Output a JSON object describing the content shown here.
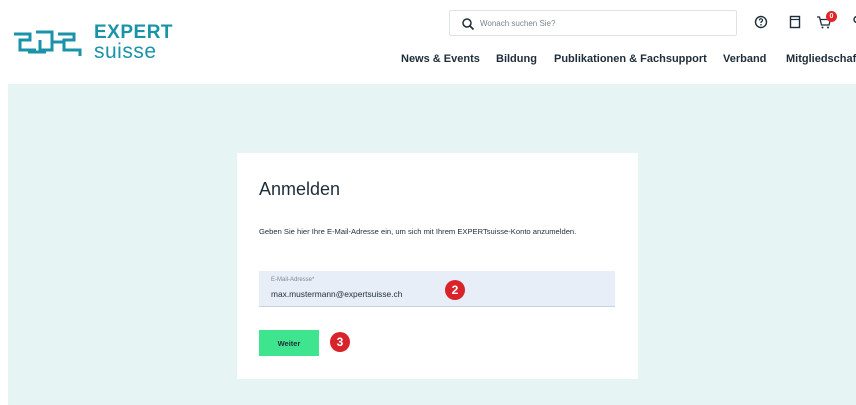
{
  "brand": {
    "line1": "EXPERT",
    "line2": "suisse",
    "color": "#1a93a8"
  },
  "search": {
    "placeholder": "Wonach suchen Sie?"
  },
  "header_icons": [
    "help-icon",
    "document-icon",
    "cart-icon",
    "user-icon"
  ],
  "cart": {
    "count": "0"
  },
  "nav": {
    "items": [
      "News & Events",
      "Bildung",
      "Publikationen & Fachsupport",
      "Verband",
      "Mitgliedschaft"
    ]
  },
  "login": {
    "title": "Anmelden",
    "description": "Geben Sie hier Ihre E-Mail-Adresse ein, um sich mit Ihrem EXPERTsuisse-Konto anzumelden.",
    "email_label": "E-Mail-Adresse*",
    "email_value": "max.mustermann@expertsuisse.ch",
    "button_label": "Weiter",
    "button_color": "#3fe58e"
  },
  "markers": {
    "email": "2",
    "button": "3",
    "color": "#d9232a"
  },
  "colors": {
    "hero_bg": "#e6f4f4",
    "text": "#1f2d3a"
  }
}
